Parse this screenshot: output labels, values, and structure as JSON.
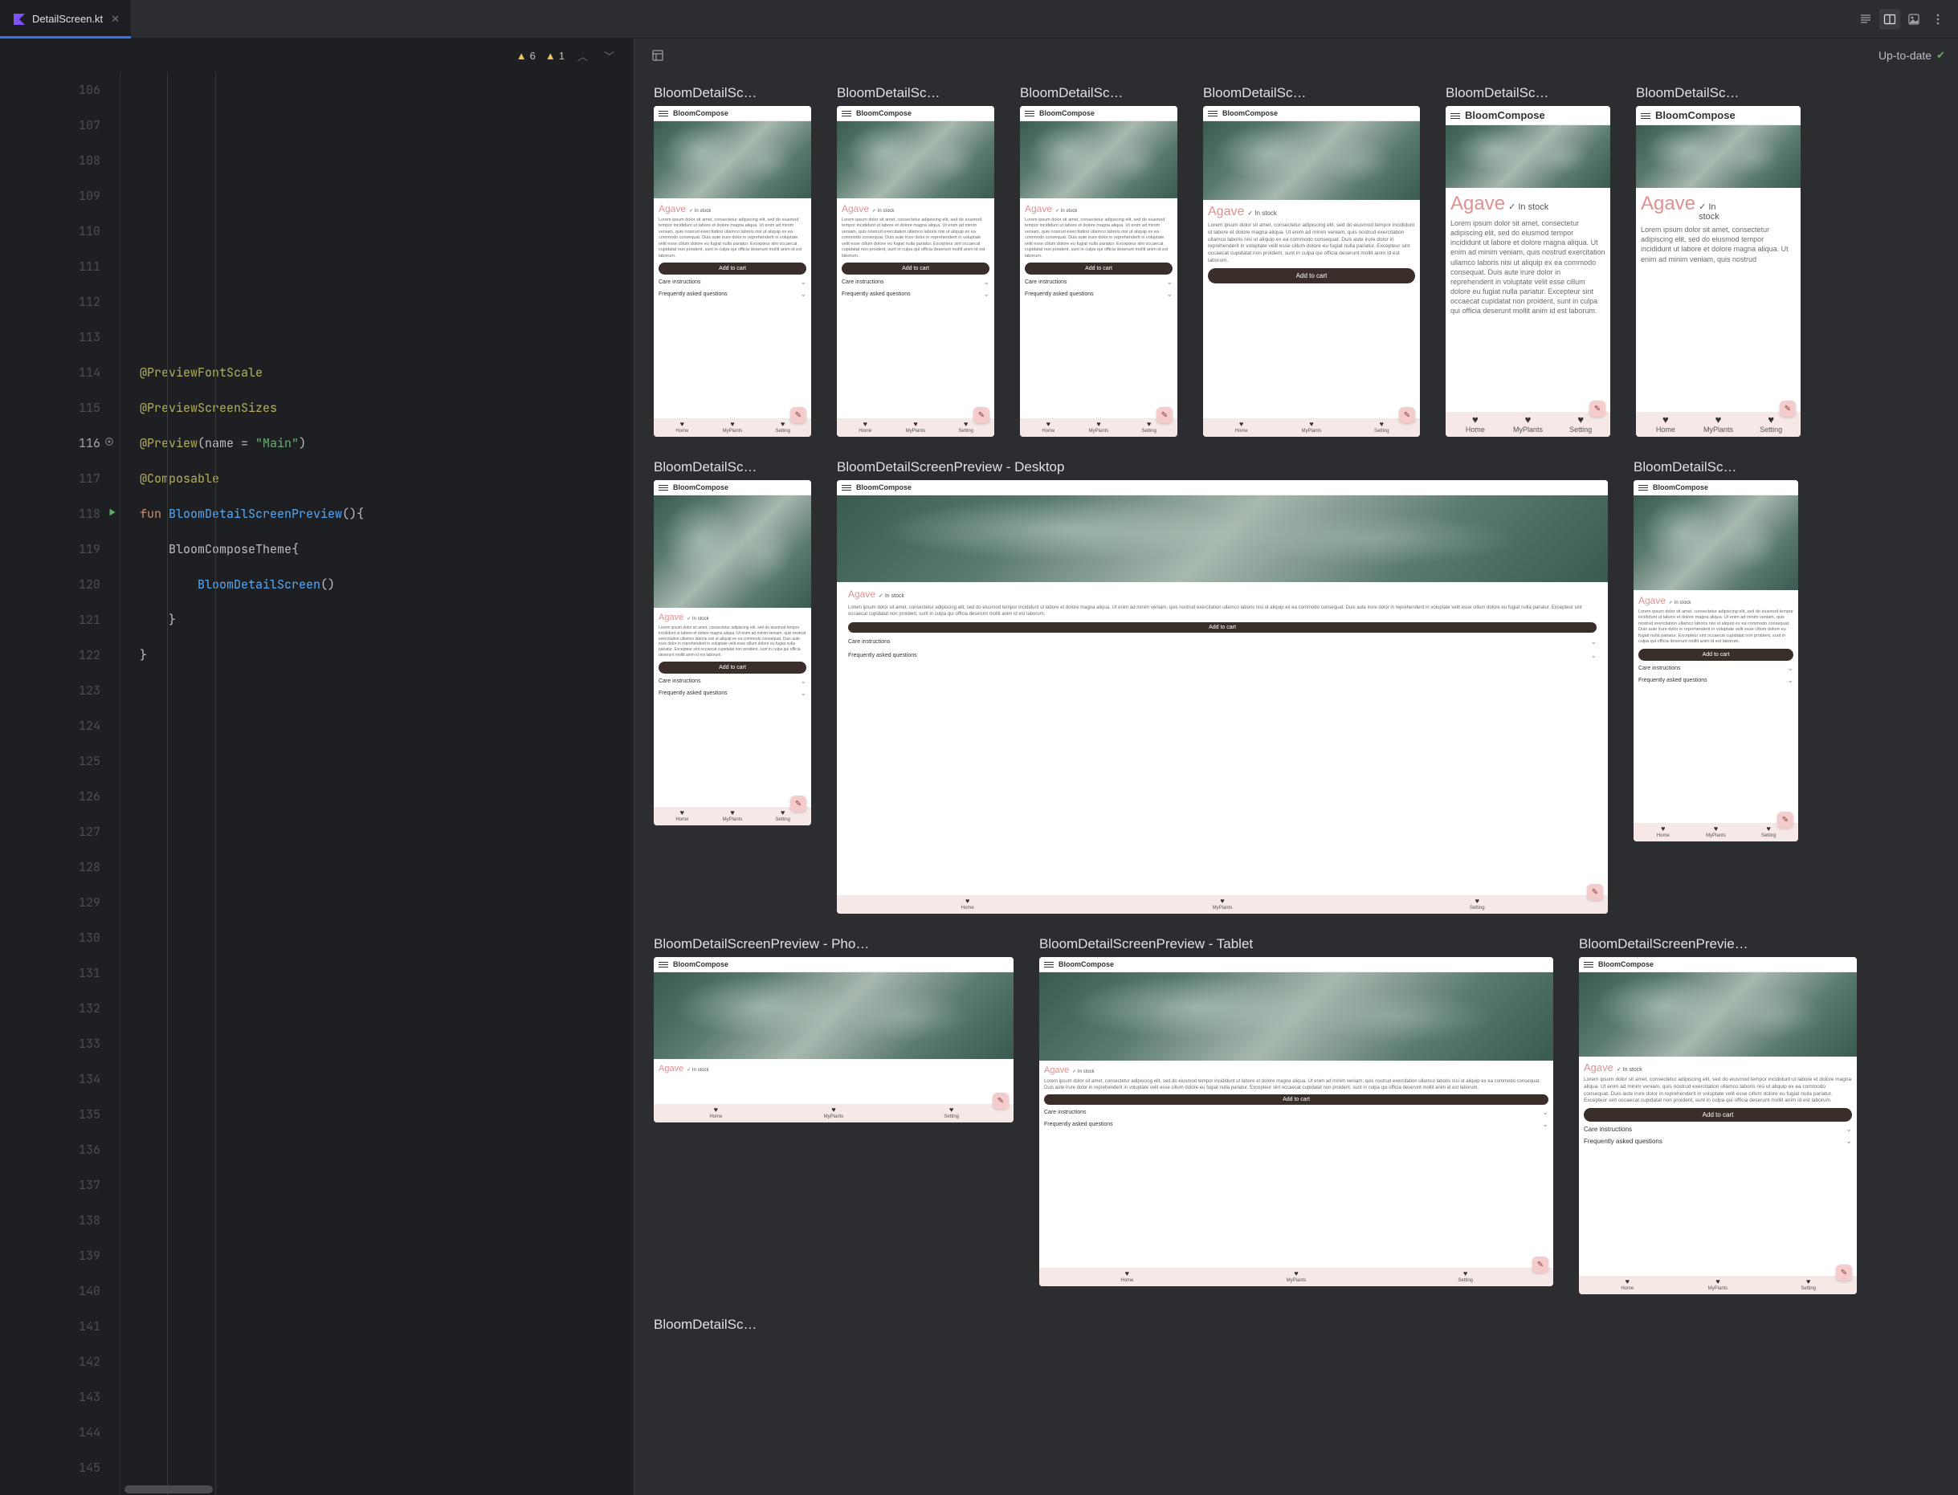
{
  "tab": {
    "filename": "DetailScreen.kt"
  },
  "inspections": {
    "weak_warning_count": "6",
    "warning_count": "1"
  },
  "preview": {
    "status": "Up-to-date"
  },
  "editor": {
    "line_start": 106,
    "line_end": 145,
    "current_line": 116,
    "code_lines": [
      {
        "n": 106,
        "tokens": []
      },
      {
        "n": 107,
        "tokens": []
      },
      {
        "n": 108,
        "tokens": []
      },
      {
        "n": 109,
        "tokens": []
      },
      {
        "n": 110,
        "tokens": []
      },
      {
        "n": 111,
        "tokens": []
      },
      {
        "n": 112,
        "tokens": []
      },
      {
        "n": 113,
        "tokens": []
      },
      {
        "n": 114,
        "tokens": [
          {
            "c": "tok-annotation",
            "t": "@PreviewFontScale"
          }
        ]
      },
      {
        "n": 115,
        "tokens": [
          {
            "c": "tok-annotation",
            "t": "@PreviewScreenSizes"
          }
        ]
      },
      {
        "n": 116,
        "tokens": [
          {
            "c": "tok-annotation",
            "t": "@Preview"
          },
          {
            "c": "tok-brace",
            "t": "("
          },
          {
            "c": "tok-funccall",
            "t": "name = "
          },
          {
            "c": "tok-string",
            "t": "\"Main\""
          },
          {
            "c": "tok-brace",
            "t": ")"
          }
        ],
        "gear": true
      },
      {
        "n": 117,
        "tokens": [
          {
            "c": "tok-annotation",
            "t": "@Composable"
          }
        ]
      },
      {
        "n": 118,
        "tokens": [
          {
            "c": "tok-keyword",
            "t": "fun "
          },
          {
            "c": "tok-funcname",
            "t": "BloomDetailScreenPreview"
          },
          {
            "c": "tok-brace",
            "t": "(){"
          }
        ],
        "run": true
      },
      {
        "n": 119,
        "indent": 1,
        "tokens": [
          {
            "c": "tok-funccall",
            "t": "BloomComposeTheme"
          },
          {
            "c": "tok-brace",
            "t": "{"
          }
        ]
      },
      {
        "n": 120,
        "indent": 2,
        "tokens": [
          {
            "c": "tok-comment-func",
            "t": "BloomDetailScreen"
          },
          {
            "c": "tok-brace",
            "t": "()"
          }
        ]
      },
      {
        "n": 121,
        "indent": 1,
        "tokens": [
          {
            "c": "tok-brace",
            "t": "}"
          }
        ]
      },
      {
        "n": 122,
        "tokens": [
          {
            "c": "tok-brace",
            "t": "}"
          }
        ]
      },
      {
        "n": 123,
        "tokens": []
      },
      {
        "n": 124,
        "tokens": []
      },
      {
        "n": 125,
        "tokens": []
      },
      {
        "n": 126,
        "tokens": []
      },
      {
        "n": 127,
        "tokens": []
      },
      {
        "n": 128,
        "tokens": []
      },
      {
        "n": 129,
        "tokens": []
      },
      {
        "n": 130,
        "tokens": []
      },
      {
        "n": 131,
        "tokens": []
      },
      {
        "n": 132,
        "tokens": []
      },
      {
        "n": 133,
        "tokens": []
      },
      {
        "n": 134,
        "tokens": []
      },
      {
        "n": 135,
        "tokens": []
      },
      {
        "n": 136,
        "tokens": []
      },
      {
        "n": 137,
        "tokens": []
      },
      {
        "n": 138,
        "tokens": []
      },
      {
        "n": 139,
        "tokens": []
      },
      {
        "n": 140,
        "tokens": []
      },
      {
        "n": 141,
        "tokens": []
      },
      {
        "n": 142,
        "tokens": []
      },
      {
        "n": 143,
        "tokens": []
      },
      {
        "n": 144,
        "tokens": []
      },
      {
        "n": 145,
        "tokens": []
      }
    ]
  },
  "previews": {
    "app_name": "BloomCompose",
    "plant_title": "Agave",
    "stock_label": "✓ In stock",
    "lorem_short": "Lorem ipsum dolor sit amet, consectetur adipiscing elit, sed do eiusmod tempor incididunt ut labore et dolore magna aliqua.",
    "lorem_long": "Lorem ipsum dolor sit amet, consectetur adipiscing elit, sed do eiusmod tempor incididunt ut labore et dolore magna aliqua. Ut enim ad minim veniam, quis nostrud exercitation ullamco laboris nisi ut aliquip ex ea commodo consequat. Duis aute irure dolor in reprehenderit in voluptate velit esse cillum dolore eu fugiat nulla pariatur. Excepteur sint occaecat cupidatat non proident, sunt in culpa qui officia deserunt mollit anim id est laborum.",
    "add_to_cart": "Add to cart",
    "care_instructions": "Care instructions",
    "faq": "Frequently asked questions",
    "nav": {
      "home": "Home",
      "my_plants": "MyPlants",
      "setting": "Setting"
    },
    "row1": [
      {
        "label": "BloomDetailSc…"
      },
      {
        "label": "BloomDetailSc…"
      },
      {
        "label": "BloomDetailSc…"
      },
      {
        "label": "BloomDetailSc…"
      },
      {
        "label": "BloomDetailSc…"
      },
      {
        "label": "BloomDetailSc…"
      }
    ],
    "row2": [
      {
        "label": "BloomDetailSc…"
      },
      {
        "label": "BloomDetailScreenPreview - Desktop"
      },
      {
        "label": "BloomDetailSc…"
      }
    ],
    "row3": [
      {
        "label": "BloomDetailScreenPreview - Pho…"
      },
      {
        "label": "BloomDetailScreenPreview - Tablet"
      },
      {
        "label": "BloomDetailScreenPrevie…"
      }
    ],
    "row4": [
      {
        "label": "BloomDetailSc…"
      }
    ]
  }
}
